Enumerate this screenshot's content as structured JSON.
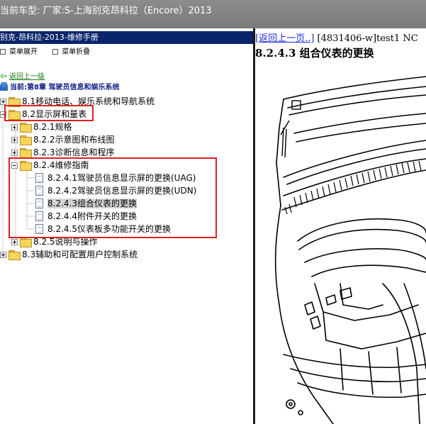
{
  "topbar": {
    "title": "当前车型:  厂家:S-上海别克昂科拉（Encore）2013"
  },
  "left_pane": {
    "header": "别克-昂科拉-2013-维修手册",
    "toolbar": {
      "expand": "菜单展开",
      "collapse": "菜单折叠"
    },
    "back_link": "返回上一级",
    "current": "当前:第8章 驾驶员信息和娱乐系统",
    "tree": [
      {
        "label": "8.1移动电话、娱乐系统和导航系统"
      },
      {
        "label": "8.2显示屏和量表"
      },
      {
        "label": "8.2.1规格"
      },
      {
        "label": "8.2.2示意图和布线图"
      },
      {
        "label": "8.2.3诊断信息和程序"
      },
      {
        "label": "8.2.4维修指南"
      },
      {
        "label": "8.2.4.1驾驶员信息显示屏的更换(UAG)"
      },
      {
        "label": "8.2.4.2驾驶员信息显示屏的更换(UDN)"
      },
      {
        "label": "8.2.4.3组合仪表的更换"
      },
      {
        "label": "8.2.4.4附件开关的更换"
      },
      {
        "label": "8.2.4.5仪表板多功能开关的更换"
      },
      {
        "label": "8.2.5说明与操作"
      },
      {
        "label": "8.3辅助和可配置用户控制系统"
      }
    ]
  },
  "right_pane": {
    "back_link": "[返回上一页..]",
    "doc_ref": " [4831406-w]test1 NC",
    "heading": "8.2.4.3 组合仪表的更换"
  },
  "colors": {
    "topbar": "#7f7f7f",
    "header_bg": "#0a246a",
    "highlight_box": "#e02020",
    "link": "#1a2ad8",
    "back_link": "#1a7a1a"
  }
}
